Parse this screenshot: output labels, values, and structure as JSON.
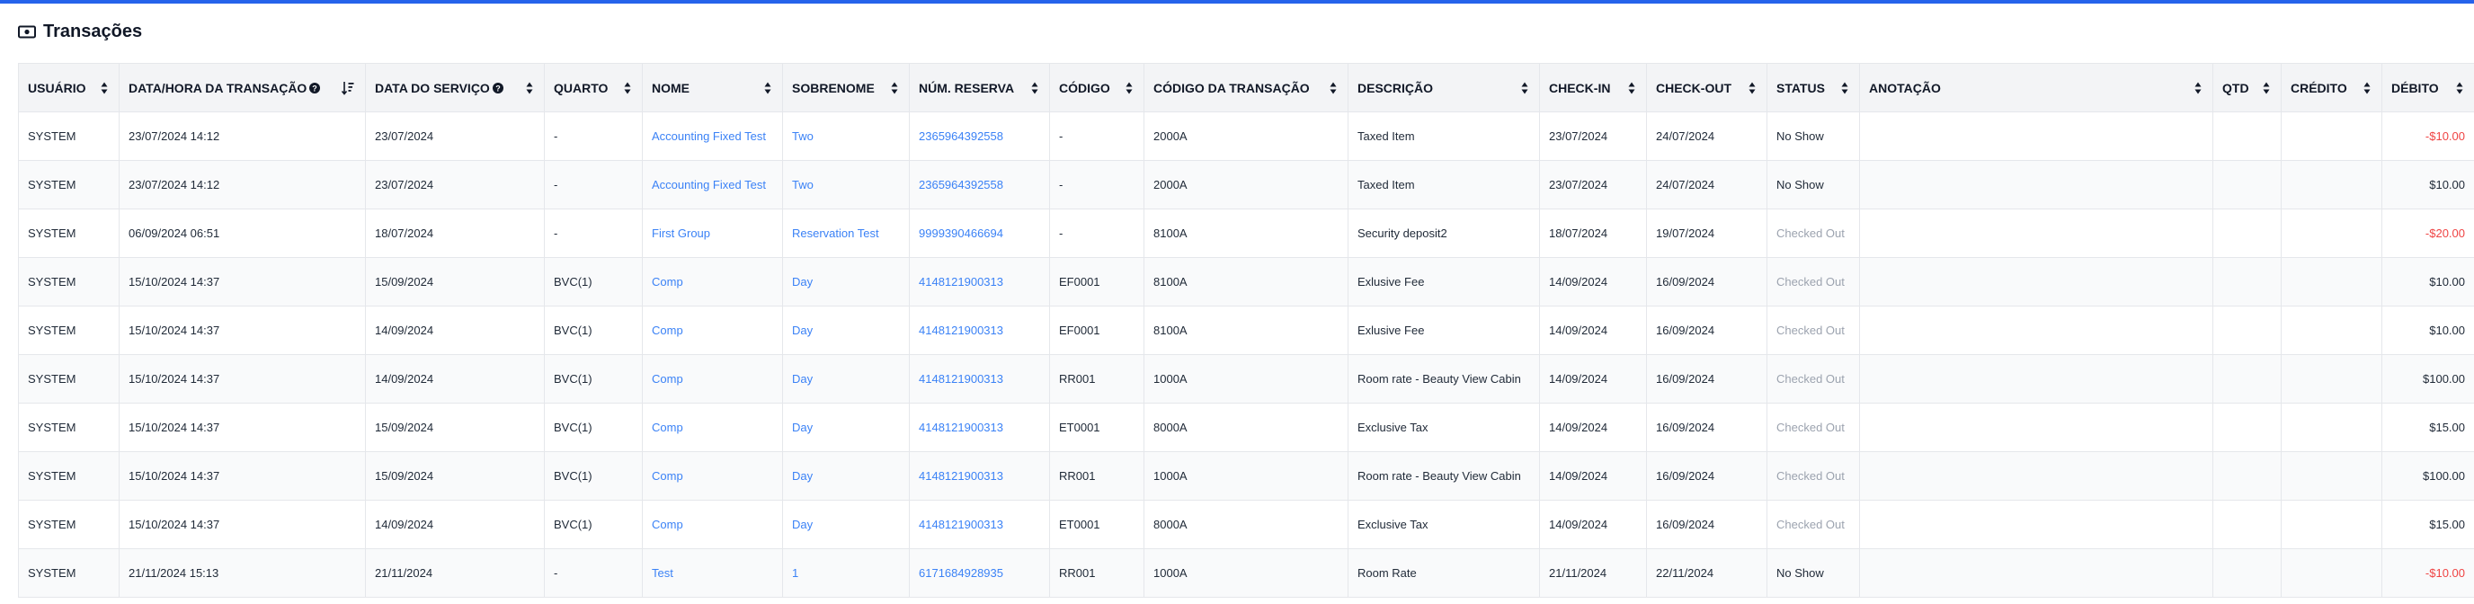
{
  "title": "Transações",
  "colors": {
    "accent": "#2563eb",
    "link": "#3b82f6",
    "negative": "#ef4444",
    "muted": "#9ca3af"
  },
  "columns": [
    {
      "key": "usuario",
      "label": "USUÁRIO",
      "help": false,
      "sort": "none"
    },
    {
      "key": "data_hora",
      "label": "DATA/HORA DA TRANSAÇÃO",
      "help": true,
      "sort": "active"
    },
    {
      "key": "data_servico",
      "label": "DATA DO SERVIÇO",
      "help": true,
      "sort": "none"
    },
    {
      "key": "quarto",
      "label": "QUARTO",
      "help": false,
      "sort": "none"
    },
    {
      "key": "nome",
      "label": "NOME",
      "help": false,
      "sort": "none"
    },
    {
      "key": "sobrenome",
      "label": "SOBRENOME",
      "help": false,
      "sort": "none"
    },
    {
      "key": "reserva",
      "label": "NÚM. RESERVA",
      "help": false,
      "sort": "none"
    },
    {
      "key": "codigo",
      "label": "CÓDIGO",
      "help": false,
      "sort": "none"
    },
    {
      "key": "codigo_transacao",
      "label": "CÓDIGO DA TRANSAÇÃO",
      "help": false,
      "sort": "none"
    },
    {
      "key": "descricao",
      "label": "DESCRIÇÃO",
      "help": false,
      "sort": "none"
    },
    {
      "key": "checkin",
      "label": "CHECK-IN",
      "help": false,
      "sort": "none"
    },
    {
      "key": "checkout",
      "label": "CHECK-OUT",
      "help": false,
      "sort": "none"
    },
    {
      "key": "status",
      "label": "STATUS",
      "help": false,
      "sort": "none"
    },
    {
      "key": "anotacao",
      "label": "ANOTAÇÃO",
      "help": false,
      "sort": "none"
    },
    {
      "key": "qtd",
      "label": "QTD",
      "help": false,
      "sort": "none"
    },
    {
      "key": "credito",
      "label": "CRÉDITO",
      "help": false,
      "sort": "none"
    },
    {
      "key": "debito",
      "label": "DÉBITO",
      "help": false,
      "sort": "none"
    }
  ],
  "rows": [
    {
      "usuario": "SYSTEM",
      "data_hora": "23/07/2024 14:12",
      "data_servico": "23/07/2024",
      "quarto": "-",
      "nome": "Accounting Fixed Test",
      "sobrenome": "Two",
      "reserva": "2365964392558",
      "codigo": "-",
      "codigo_transacao": "2000A",
      "descricao": "Taxed Item",
      "checkin": "23/07/2024",
      "checkout": "24/07/2024",
      "status": "No Show",
      "anotacao": "",
      "qtd": "",
      "credito": "",
      "debito": "-$10.00"
    },
    {
      "usuario": "SYSTEM",
      "data_hora": "23/07/2024 14:12",
      "data_servico": "23/07/2024",
      "quarto": "-",
      "nome": "Accounting Fixed Test",
      "sobrenome": "Two",
      "reserva": "2365964392558",
      "codigo": "-",
      "codigo_transacao": "2000A",
      "descricao": "Taxed Item",
      "checkin": "23/07/2024",
      "checkout": "24/07/2024",
      "status": "No Show",
      "anotacao": "",
      "qtd": "",
      "credito": "",
      "debito": "$10.00"
    },
    {
      "usuario": "SYSTEM",
      "data_hora": "06/09/2024 06:51",
      "data_servico": "18/07/2024",
      "quarto": "-",
      "nome": "First Group",
      "sobrenome": "Reservation Test",
      "reserva": "9999390466694",
      "codigo": "-",
      "codigo_transacao": "8100A",
      "descricao": "Security deposit2",
      "checkin": "18/07/2024",
      "checkout": "19/07/2024",
      "status": "Checked Out",
      "anotacao": "",
      "qtd": "",
      "credito": "",
      "debito": "-$20.00"
    },
    {
      "usuario": "SYSTEM",
      "data_hora": "15/10/2024 14:37",
      "data_servico": "15/09/2024",
      "quarto": "BVC(1)",
      "nome": "Comp",
      "sobrenome": "Day",
      "reserva": "4148121900313",
      "codigo": "EF0001",
      "codigo_transacao": "8100A",
      "descricao": "Exlusive Fee",
      "checkin": "14/09/2024",
      "checkout": "16/09/2024",
      "status": "Checked Out",
      "anotacao": "",
      "qtd": "",
      "credito": "",
      "debito": "$10.00"
    },
    {
      "usuario": "SYSTEM",
      "data_hora": "15/10/2024 14:37",
      "data_servico": "14/09/2024",
      "quarto": "BVC(1)",
      "nome": "Comp",
      "sobrenome": "Day",
      "reserva": "4148121900313",
      "codigo": "EF0001",
      "codigo_transacao": "8100A",
      "descricao": "Exlusive Fee",
      "checkin": "14/09/2024",
      "checkout": "16/09/2024",
      "status": "Checked Out",
      "anotacao": "",
      "qtd": "",
      "credito": "",
      "debito": "$10.00"
    },
    {
      "usuario": "SYSTEM",
      "data_hora": "15/10/2024 14:37",
      "data_servico": "14/09/2024",
      "quarto": "BVC(1)",
      "nome": "Comp",
      "sobrenome": "Day",
      "reserva": "4148121900313",
      "codigo": "RR001",
      "codigo_transacao": "1000A",
      "descricao": "Room rate - Beauty View Cabin",
      "checkin": "14/09/2024",
      "checkout": "16/09/2024",
      "status": "Checked Out",
      "anotacao": "",
      "qtd": "",
      "credito": "",
      "debito": "$100.00"
    },
    {
      "usuario": "SYSTEM",
      "data_hora": "15/10/2024 14:37",
      "data_servico": "15/09/2024",
      "quarto": "BVC(1)",
      "nome": "Comp",
      "sobrenome": "Day",
      "reserva": "4148121900313",
      "codigo": "ET0001",
      "codigo_transacao": "8000A",
      "descricao": "Exclusive Tax",
      "checkin": "14/09/2024",
      "checkout": "16/09/2024",
      "status": "Checked Out",
      "anotacao": "",
      "qtd": "",
      "credito": "",
      "debito": "$15.00"
    },
    {
      "usuario": "SYSTEM",
      "data_hora": "15/10/2024 14:37",
      "data_servico": "15/09/2024",
      "quarto": "BVC(1)",
      "nome": "Comp",
      "sobrenome": "Day",
      "reserva": "4148121900313",
      "codigo": "RR001",
      "codigo_transacao": "1000A",
      "descricao": "Room rate - Beauty View Cabin",
      "checkin": "14/09/2024",
      "checkout": "16/09/2024",
      "status": "Checked Out",
      "anotacao": "",
      "qtd": "",
      "credito": "",
      "debito": "$100.00"
    },
    {
      "usuario": "SYSTEM",
      "data_hora": "15/10/2024 14:37",
      "data_servico": "14/09/2024",
      "quarto": "BVC(1)",
      "nome": "Comp",
      "sobrenome": "Day",
      "reserva": "4148121900313",
      "codigo": "ET0001",
      "codigo_transacao": "8000A",
      "descricao": "Exclusive Tax",
      "checkin": "14/09/2024",
      "checkout": "16/09/2024",
      "status": "Checked Out",
      "anotacao": "",
      "qtd": "",
      "credito": "",
      "debito": "$15.00"
    },
    {
      "usuario": "SYSTEM",
      "data_hora": "21/11/2024 15:13",
      "data_servico": "21/11/2024",
      "quarto": "-",
      "nome": "Test",
      "sobrenome": "1",
      "reserva": "6171684928935",
      "codigo": "RR001",
      "codigo_transacao": "1000A",
      "descricao": "Room Rate",
      "checkin": "21/11/2024",
      "checkout": "22/11/2024",
      "status": "No Show",
      "anotacao": "",
      "qtd": "",
      "credito": "",
      "debito": "-$10.00"
    }
  ]
}
